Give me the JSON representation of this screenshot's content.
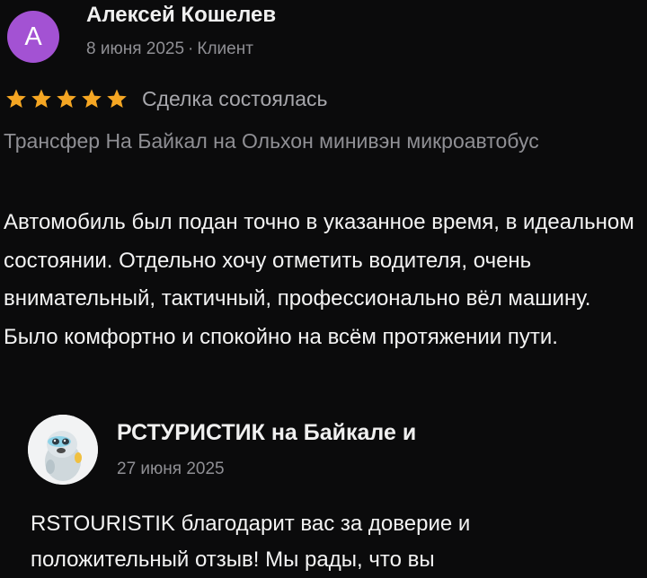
{
  "review": {
    "avatar_letter": "А",
    "avatar_color": "#a352d3",
    "author": "Алексей Кошелев",
    "date": "8 июня 2025",
    "separator": "·",
    "role": "Клиент",
    "rating": 5,
    "rating_max": 5,
    "star_color": "#f5a623",
    "star_icon": "star-icon",
    "deal_status": "Сделка состоялась",
    "trip_title": "Трансфер На Байкал на Ольхон минивэн микроавтобус",
    "text": "Автомобиль был подан точно в указанное время, в идеальном состоянии. Отдельно хочу отметить водителя, очень внимательный, тактичный, профессионально вёл машину. Было комфортно и спокойно на всём протяжении пути."
  },
  "reply": {
    "avatar_icon": "seal-mascot-avatar",
    "author": "РСТУРИСТИК на Байкале и",
    "date": "27 июня 2025",
    "text": "RSTOURISTIK благодарит вас за доверие и положительный отзыв! Мы рады, что вы"
  }
}
